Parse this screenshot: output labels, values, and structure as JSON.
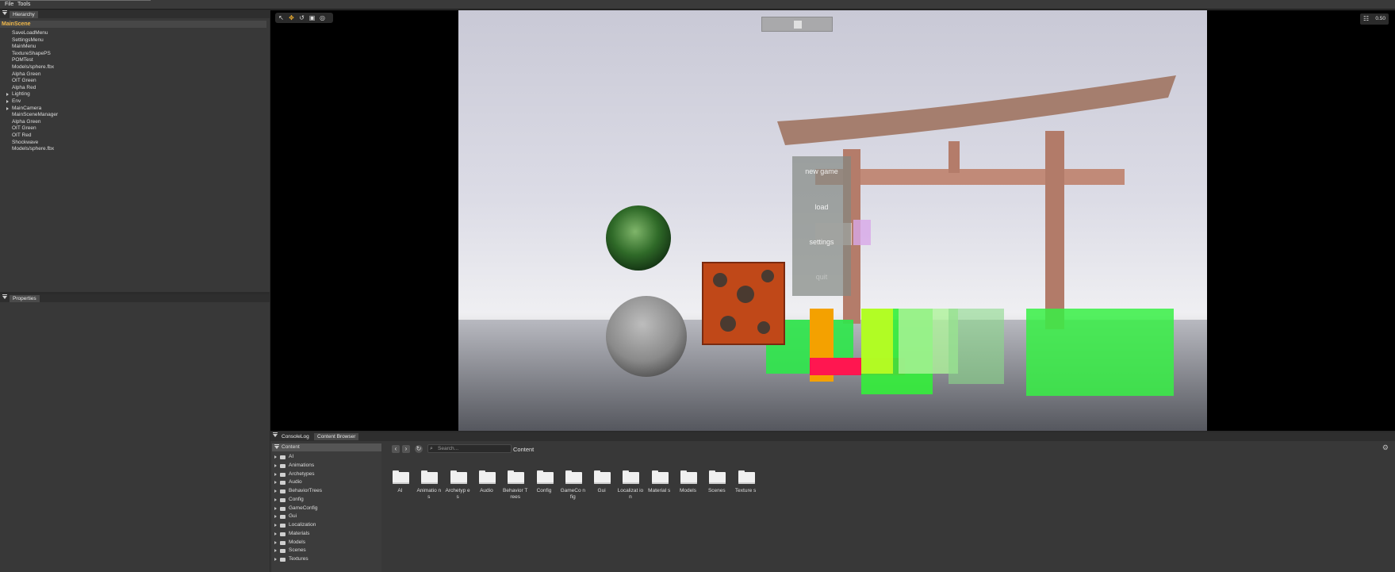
{
  "menubar": {
    "file": "File",
    "tools": "Tools"
  },
  "hierarchy": {
    "tab": "Hierarchy",
    "root": "MainScene",
    "items": [
      {
        "label": "SaveLoadMenu",
        "expandable": false
      },
      {
        "label": "SettingsMenu",
        "expandable": false
      },
      {
        "label": "MainMenu",
        "expandable": false
      },
      {
        "label": "TextureShapePS",
        "expandable": false
      },
      {
        "label": "POMTest",
        "expandable": false
      },
      {
        "label": "Models/sphere.fbx",
        "expandable": false
      },
      {
        "label": "Alpha Green",
        "expandable": false
      },
      {
        "label": "OIT Green",
        "expandable": false
      },
      {
        "label": "Alpha Red",
        "expandable": false
      },
      {
        "label": "Lighting",
        "expandable": true
      },
      {
        "label": "Env",
        "expandable": true
      },
      {
        "label": "MainCamera",
        "expandable": true
      },
      {
        "label": "MainSceneManager",
        "expandable": false
      },
      {
        "label": "Alpha Green",
        "expandable": false
      },
      {
        "label": "OIT Green",
        "expandable": false
      },
      {
        "label": "OIT Red",
        "expandable": false
      },
      {
        "label": "Shockwave",
        "expandable": false
      },
      {
        "label": "Models/sphere.fbx",
        "expandable": false
      }
    ]
  },
  "properties": {
    "tab": "Properties"
  },
  "viewport": {
    "tools": [
      "select-icon",
      "move-icon",
      "rotate-icon",
      "scale-icon",
      "transform-icon"
    ],
    "grid_icon": "grid-icon",
    "grid_value": "0.50",
    "game_menu": {
      "items": [
        "new game",
        "load",
        "settings",
        "quit"
      ]
    }
  },
  "bottom": {
    "tabs": [
      "ConsoleLog",
      "Content Browser"
    ],
    "active_tab": "Content Browser",
    "tree_root": "Content",
    "tree_items": [
      "AI",
      "Animations",
      "Archetypes",
      "Audio",
      "BehaviorTrees",
      "Config",
      "GameConfig",
      "Gui",
      "Localization",
      "Materials",
      "Models",
      "Scenes",
      "Textures"
    ],
    "search_placeholder": "Search...",
    "path": "Content",
    "folders": [
      "AI",
      "Animatio ns",
      "Archetyp es",
      "Audio",
      "Behavior Trees",
      "Config",
      "GameCo nfig",
      "Gui",
      "Localizat ion",
      "Material s",
      "Models",
      "Scenes",
      "Texture s"
    ]
  }
}
